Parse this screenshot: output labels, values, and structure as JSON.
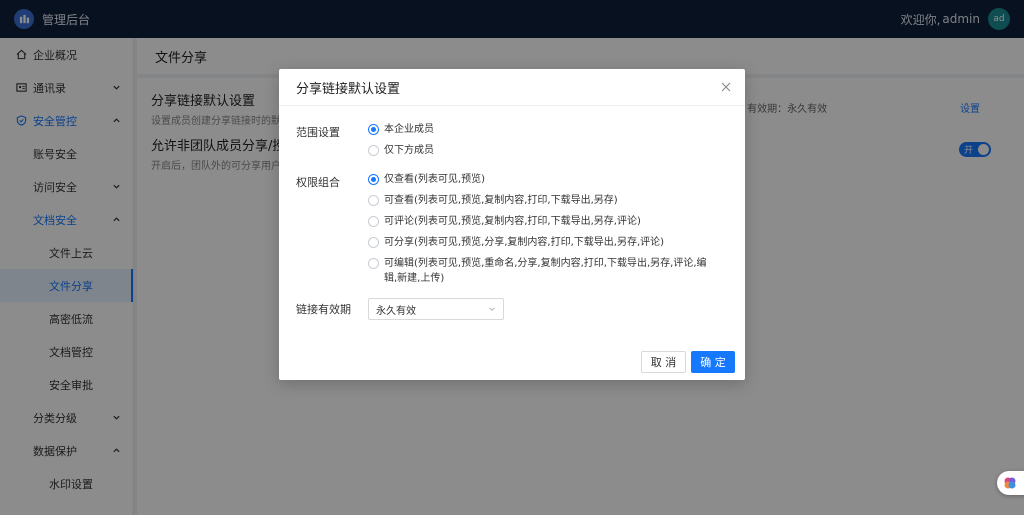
{
  "header": {
    "app_title": "管理后台",
    "welcome": "欢迎你,",
    "user": "admin",
    "avatar_text": "ad"
  },
  "sidebar": {
    "items": [
      {
        "label": "企业概况",
        "icon": "home-icon"
      },
      {
        "label": "通讯录",
        "icon": "contacts-icon"
      },
      {
        "label": "安全管控",
        "icon": "shield-icon"
      },
      {
        "label": "账号安全"
      },
      {
        "label": "访问安全"
      },
      {
        "label": "文档安全"
      },
      {
        "label": "文件上云"
      },
      {
        "label": "文件分享"
      },
      {
        "label": "高密低流"
      },
      {
        "label": "文档管控"
      },
      {
        "label": "安全审批"
      },
      {
        "label": "分类分级"
      },
      {
        "label": "数据保护"
      },
      {
        "label": "水印设置"
      }
    ]
  },
  "main": {
    "page_title": "文件分享",
    "row1": {
      "title": "分享链接默认设置",
      "desc": "设置成员创建分享链接时的默认",
      "info": "看 有效期：永久有效",
      "link": "设置"
    },
    "row2": {
      "title": "允许非团队成员分享/授权",
      "desc": "开启后，团队外的可分享用户",
      "toggle_text": "开"
    }
  },
  "modal": {
    "title": "分享链接默认设置",
    "scope": {
      "label": "范围设置",
      "options": [
        "本企业成员",
        "仅下方成员"
      ],
      "selected": 0
    },
    "permission": {
      "label": "权限组合",
      "options": [
        "仅查看(列表可见,预览)",
        "可查看(列表可见,预览,复制内容,打印,下载导出,另存)",
        "可评论(列表可见,预览,复制内容,打印,下载导出,另存,评论)",
        "可分享(列表可见,预览,分享,复制内容,打印,下载导出,另存,评论)",
        "可编辑(列表可见,预览,重命名,分享,复制内容,打印,下载导出,另存,评论,编辑,新建,上传)"
      ],
      "selected": 0
    },
    "expiry": {
      "label": "链接有效期",
      "value": "永久有效"
    },
    "cancel_label": "取 消",
    "ok_label": "确 定"
  },
  "colors": {
    "accent": "#1677ff",
    "header_bg": "#0f1f3a"
  }
}
